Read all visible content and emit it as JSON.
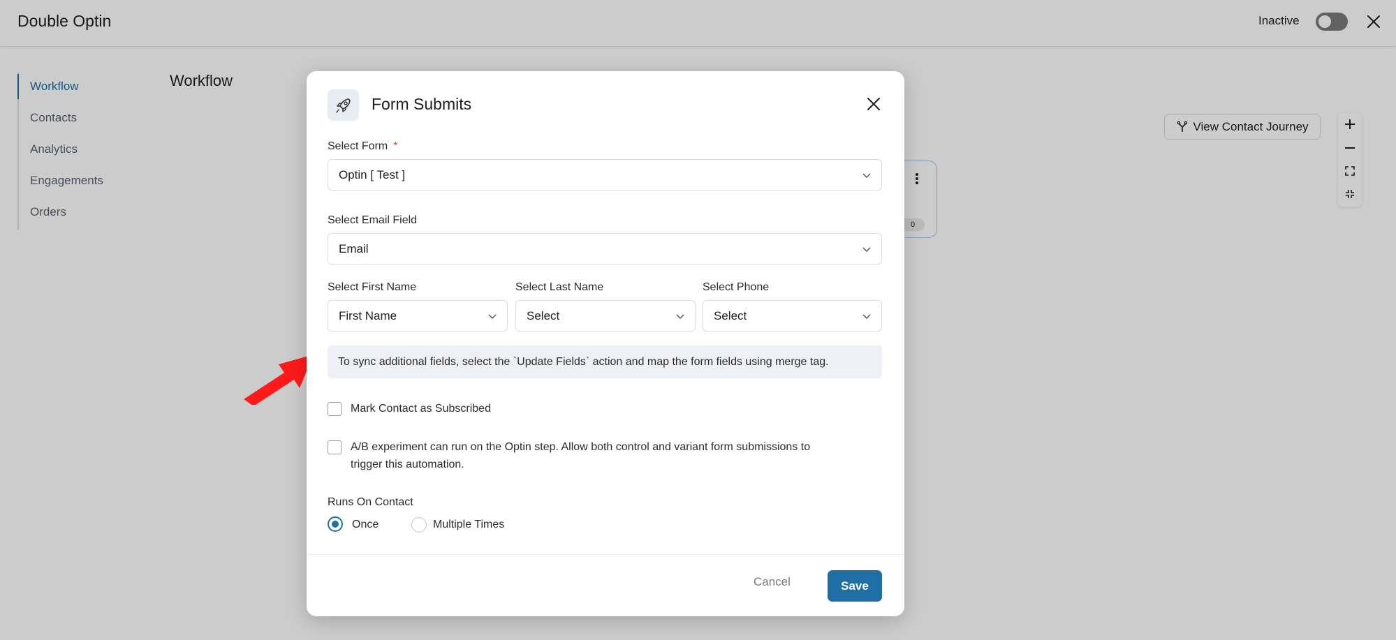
{
  "header": {
    "title": "Double Optin",
    "status_label": "Inactive",
    "toggle_on": false
  },
  "sidebar": {
    "items": [
      {
        "label": "Workflow",
        "active": true
      },
      {
        "label": "Contacts",
        "active": false
      },
      {
        "label": "Analytics",
        "active": false
      },
      {
        "label": "Engagements",
        "active": false
      },
      {
        "label": "Orders",
        "active": false
      }
    ]
  },
  "main": {
    "heading": "Workflow",
    "journey_button": "View Contact Journey",
    "node_count": "0"
  },
  "modal": {
    "title": "Form Submits",
    "icon": "rocket-icon",
    "select_form": {
      "label": "Select Form",
      "required_mark": "*",
      "value": "Optin [ Test ]"
    },
    "select_email": {
      "label": "Select Email Field",
      "value": "Email"
    },
    "select_first_name": {
      "label": "Select First Name",
      "value": "First Name"
    },
    "select_last_name": {
      "label": "Select Last Name",
      "value": "Select"
    },
    "select_phone": {
      "label": "Select Phone",
      "value": "Select"
    },
    "info_text": "To sync additional fields, select the `Update Fields` action and map the form fields using merge tag.",
    "mark_subscribed": {
      "label": "Mark Contact as Subscribed",
      "checked": false
    },
    "ab_experiment": {
      "label_line1": "A/B experiment can run on the Optin step. Allow both control and variant form submissions to",
      "label_line2": "trigger this automation.",
      "checked": false
    },
    "runs_on": {
      "label": "Runs On Contact",
      "options": [
        {
          "label": "Once",
          "selected": true
        },
        {
          "label": "Multiple Times",
          "selected": false
        }
      ]
    },
    "cancel_label": "Cancel",
    "save_label": "Save"
  },
  "colors": {
    "accent": "#1d6fa5",
    "annotation_arrow": "#ff1a1a"
  }
}
